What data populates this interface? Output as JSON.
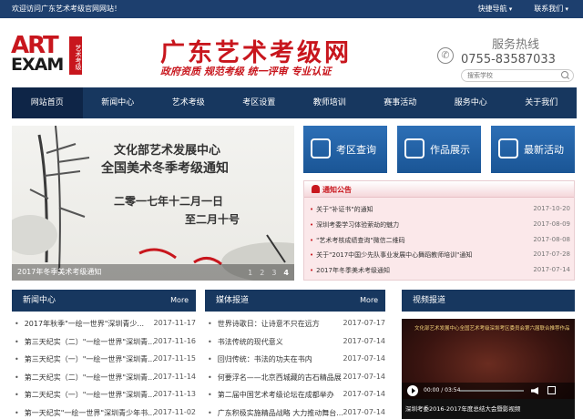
{
  "topbar": {
    "welcome": "欢迎访问广东艺术考级官网网站！",
    "links": [
      "快捷导航",
      "联系我们"
    ]
  },
  "header": {
    "logo_art": "ART",
    "logo_exam": "EXAM",
    "logo_vertical": "艺术考级",
    "title": "广东艺术考级网",
    "slogan": "政府资质  规范考级  统一评审  专业认证",
    "hotline_label": "服务热线",
    "hotline_number": "0755-83587033",
    "search_placeholder": "搜索学校"
  },
  "nav": {
    "items": [
      "网站首页",
      "新闻中心",
      "艺术考级",
      "考区设置",
      "教师培训",
      "赛事活动",
      "服务中心",
      "关于我们"
    ],
    "active_index": 0
  },
  "banner": {
    "line1": "文化部艺术发展中心",
    "line2": "全国美术冬季考级通知",
    "line3": "二零一七年十二月一日",
    "line4": "至二月十号",
    "caption": "2017年冬季美术考级通知",
    "pages": [
      "1",
      "2",
      "3",
      "4"
    ],
    "active_page": "4"
  },
  "quick": [
    {
      "label": "考区查询",
      "icon": "building-icon"
    },
    {
      "label": "作品展示",
      "icon": "image-icon"
    },
    {
      "label": "最新活动",
      "icon": "calendar-icon"
    }
  ],
  "notice": {
    "title": "通知公告",
    "items": [
      {
        "title": "关于\"补证书\"的通知",
        "date": "2017-10-20"
      },
      {
        "title": "深圳考委学习体验萦劫的魅力",
        "date": "2017-08-09"
      },
      {
        "title": "\"艺术考核成绩查询\"微信二维码",
        "date": "2017-08-08"
      },
      {
        "title": "关于\"2017中国少先队事业发展中心舞蹈教师培训\"通知",
        "date": "2017-07-28"
      },
      {
        "title": "2017年冬季美术考级通知",
        "date": "2017-07-14"
      }
    ]
  },
  "news": {
    "title": "新闻中心",
    "more": "More",
    "items": [
      {
        "title": "2017年秋季\"一绘一世界\"深圳青少...",
        "date": "2017-11-17"
      },
      {
        "title": "第三天纪实（二）\"一绘一世界\"深圳青...",
        "date": "2017-11-16"
      },
      {
        "title": "第三天纪实（一）\"一绘一世界\"深圳青...",
        "date": "2017-11-15"
      },
      {
        "title": "第二天纪实（二）\"一绘一世界\"深圳青...",
        "date": "2017-11-14"
      },
      {
        "title": "第二天纪实（一）\"一绘一世界\"深圳青...",
        "date": "2017-11-13"
      },
      {
        "title": "第一天纪实\"一绘一世界\"深圳青少年书...",
        "date": "2017-11-02"
      }
    ]
  },
  "media": {
    "title": "媒体报道",
    "more": "More",
    "items": [
      {
        "title": "世界诗歌日：让诗意不只在远方",
        "date": "2017-07-17"
      },
      {
        "title": "书法传统的现代意义",
        "date": "2017-07-14"
      },
      {
        "title": "回归传统：书法的功夫在书内",
        "date": "2017-07-14"
      },
      {
        "title": "何要浮名——北京西城藏的古石精品展",
        "date": "2017-07-14"
      },
      {
        "title": "第二届中国艺术考级论坛在成都举办",
        "date": "2017-07-14"
      },
      {
        "title": "广东积极实施精品战略 大力推动舞台...",
        "date": "2017-07-14"
      }
    ]
  },
  "video": {
    "title": "视频报道",
    "stage_text": "文化部艺术发展中心全国艺术考级深圳考区委员会第六届联合推荐作品展",
    "time": "00:00 / 03:54",
    "progress": 0,
    "caption": "深圳考委2016-2017年度总结大会暨影视频"
  }
}
